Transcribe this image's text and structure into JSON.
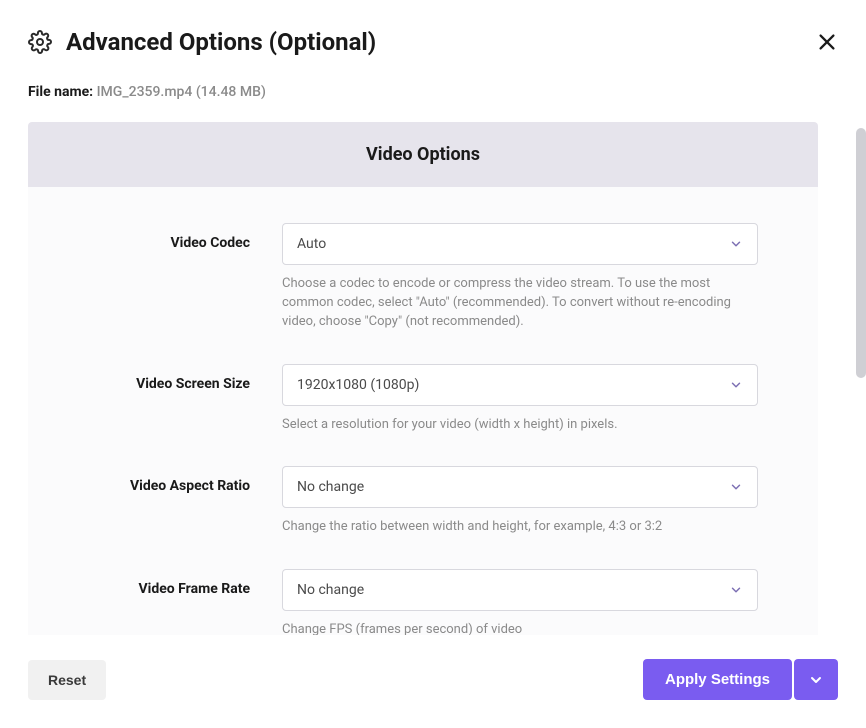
{
  "header": {
    "title": "Advanced Options (Optional)"
  },
  "file": {
    "label": "File name:",
    "value": "IMG_2359.mp4 (14.48 MB)"
  },
  "section": {
    "title": "Video Options"
  },
  "fields": {
    "codec": {
      "label": "Video Codec",
      "value": "Auto",
      "help": "Choose a codec to encode or compress the video stream. To use the most common codec, select \"Auto\" (recommended). To convert without re-encoding video, choose \"Copy\" (not recommended)."
    },
    "screenSize": {
      "label": "Video Screen Size",
      "value": "1920x1080 (1080p)",
      "help": "Select a resolution for your video (width x height) in pixels."
    },
    "aspectRatio": {
      "label": "Video Aspect Ratio",
      "value": "No change",
      "help": "Change the ratio between width and height, for example, 4:3 or 3:2"
    },
    "frameRate": {
      "label": "Video Frame Rate",
      "value": "No change",
      "help": "Change FPS (frames per second) of video"
    }
  },
  "footer": {
    "reset": "Reset",
    "apply": "Apply Settings"
  },
  "colors": {
    "accent": "#7a5cf0",
    "sectionHeaderBg": "#e6e4ec",
    "textMuted": "#8a8a8a"
  }
}
